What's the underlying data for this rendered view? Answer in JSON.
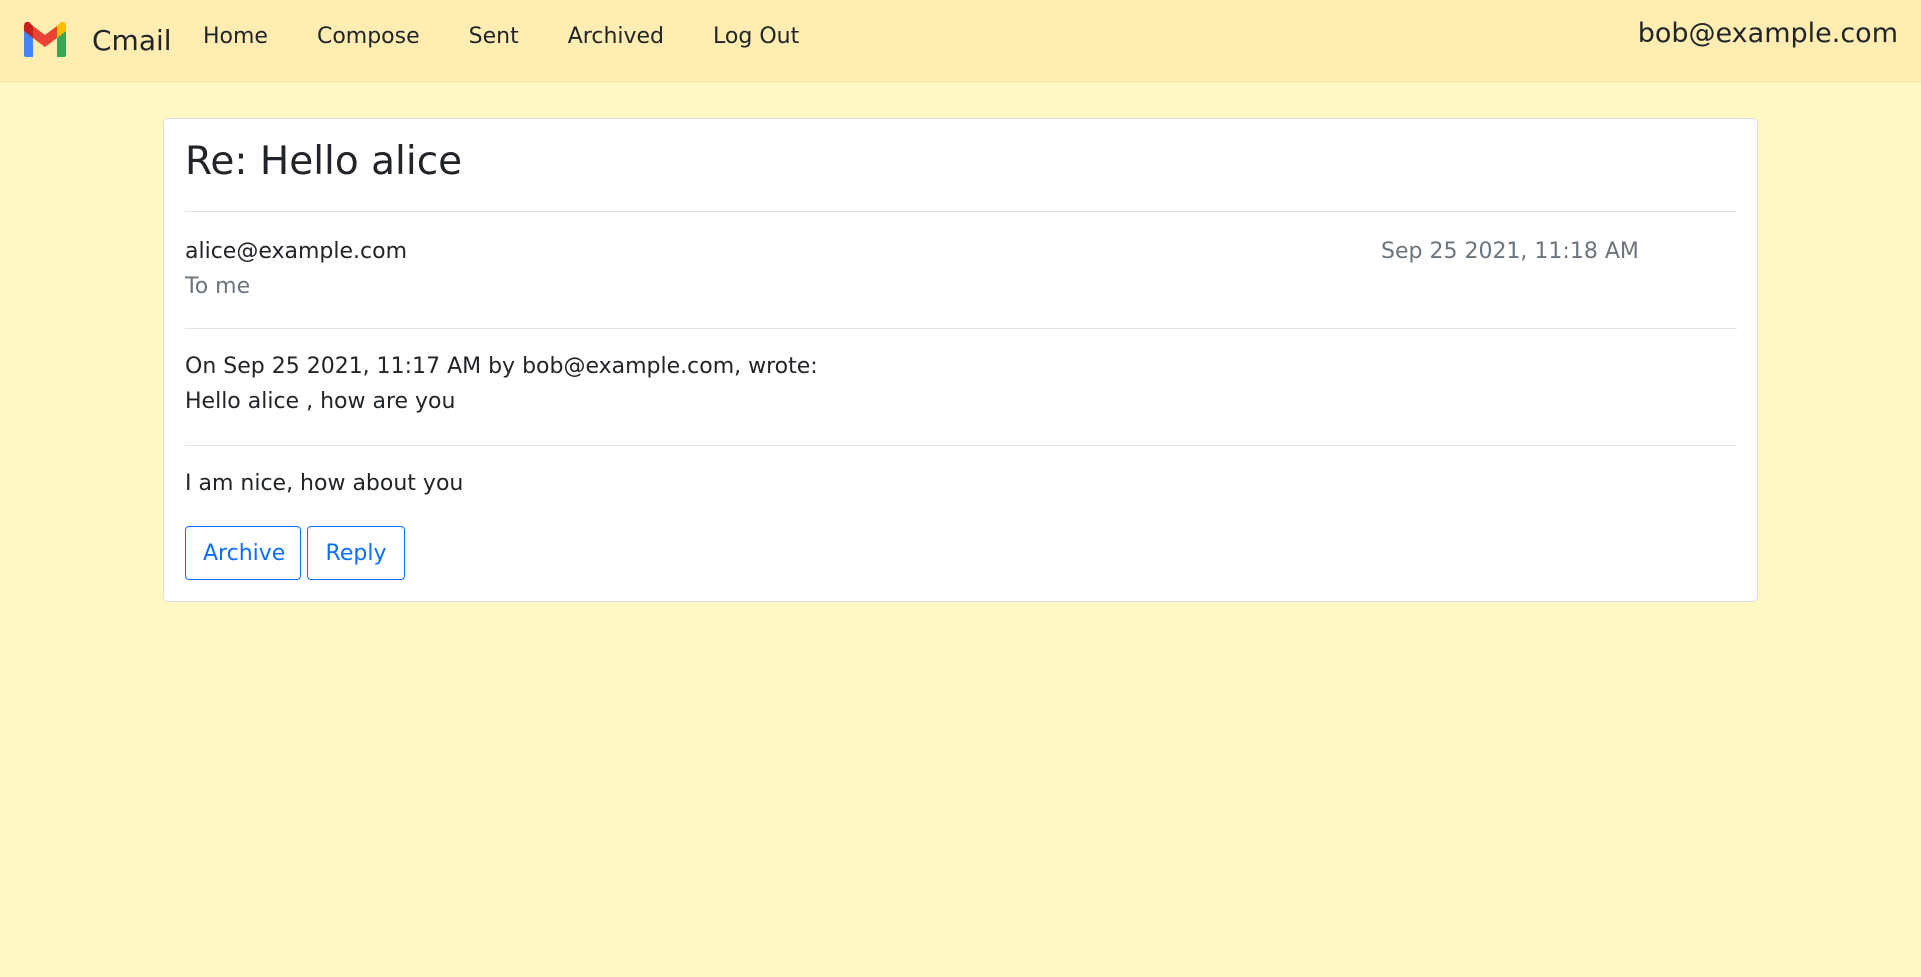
{
  "app": {
    "name": "Cmail",
    "logo_icon": "gmail-logo-icon",
    "colors": {
      "navbar_bg": "#ffedb2",
      "page_bg": "#fff8c4",
      "accent": "#0d6efd",
      "muted_text": "#6c757d"
    }
  },
  "nav": {
    "items": [
      {
        "label": "Home"
      },
      {
        "label": "Compose"
      },
      {
        "label": "Sent"
      },
      {
        "label": "Archived"
      },
      {
        "label": "Log Out"
      }
    ],
    "user_email": "bob@example.com"
  },
  "email": {
    "subject": "Re: Hello alice",
    "from": "alice@example.com",
    "to": "To me",
    "date": "Sep 25 2021, 11:18 AM",
    "quote_header": "On Sep 25 2021, 11:17 AM by bob@example.com, wrote:",
    "quote_body": "Hello alice , how are you",
    "body": "I am nice, how about you",
    "actions": {
      "archive_label": "Archive",
      "reply_label": "Reply"
    }
  }
}
